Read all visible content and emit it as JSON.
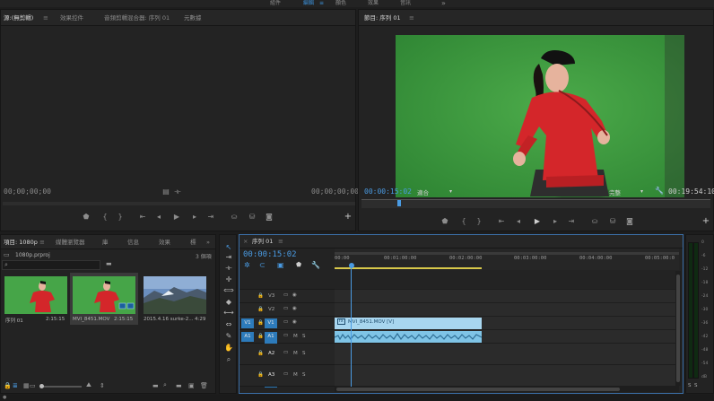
{
  "workspaces": [
    {
      "label": "組件",
      "active": false
    },
    {
      "label": "編輯",
      "active": true
    },
    {
      "label": "顏色",
      "active": false
    },
    {
      "label": "效果",
      "active": false
    },
    {
      "label": "音訊",
      "active": false
    }
  ],
  "overflow_glyph": "»",
  "source_panel": {
    "tabs": [
      "源:(無剪輯)",
      "效果控件",
      "音頻剪輯混合器: 序列 01",
      "元數據"
    ],
    "timecode_left": "00;00;00;00",
    "timecode_right": "00;00;00;00"
  },
  "program_panel": {
    "tab": "節目: 序列 01",
    "timecode_current": "00:00:15:02",
    "fit_label": "適合",
    "quality_label": "完整",
    "timecode_duration": "00:19:54:10"
  },
  "project_panel": {
    "tabs": [
      "項目: 1080p",
      "媒體瀏覽器",
      "庫",
      "信息",
      "效果",
      "標"
    ],
    "file_name": "1080p.prproj",
    "item_count": "3 個項",
    "search_icon": "search-icon",
    "items": [
      {
        "name": "序列 01",
        "duration": "2:15:15"
      },
      {
        "name": "MVI_8451.MOV",
        "duration": "2:15:15"
      },
      {
        "name": "2015.4.16 surke-2...",
        "duration": "4:29"
      }
    ]
  },
  "timeline": {
    "tab": "序列 01",
    "timecode": "00:00:15:02",
    "ruler": [
      "00:00",
      "00:01:00:00",
      "00:02:00:00",
      "00:03:00:00",
      "00:04:00:00",
      "00:05:00:0"
    ],
    "video_tracks": [
      "V3",
      "V2",
      "V1"
    ],
    "audio_tracks": [
      "A1",
      "A2",
      "A3"
    ],
    "source_video": "V1",
    "source_audio": "A1",
    "mute_label": "M",
    "solo_label": "S",
    "clip_label": "MVI_8451.MOV [V]",
    "fx_label": "fx"
  },
  "meter": {
    "labels": [
      "0",
      "-6",
      "-12",
      "-18",
      "-24",
      "-30",
      "-36",
      "-42",
      "-48",
      "-54",
      "dB"
    ],
    "solo_buttons": [
      "S",
      "S"
    ]
  },
  "colors": {
    "accent": "#4a9be3",
    "clip_video": "#a8d6ef",
    "clip_audio": "#7fc4e6",
    "source_patch": "#2d7bbb"
  }
}
